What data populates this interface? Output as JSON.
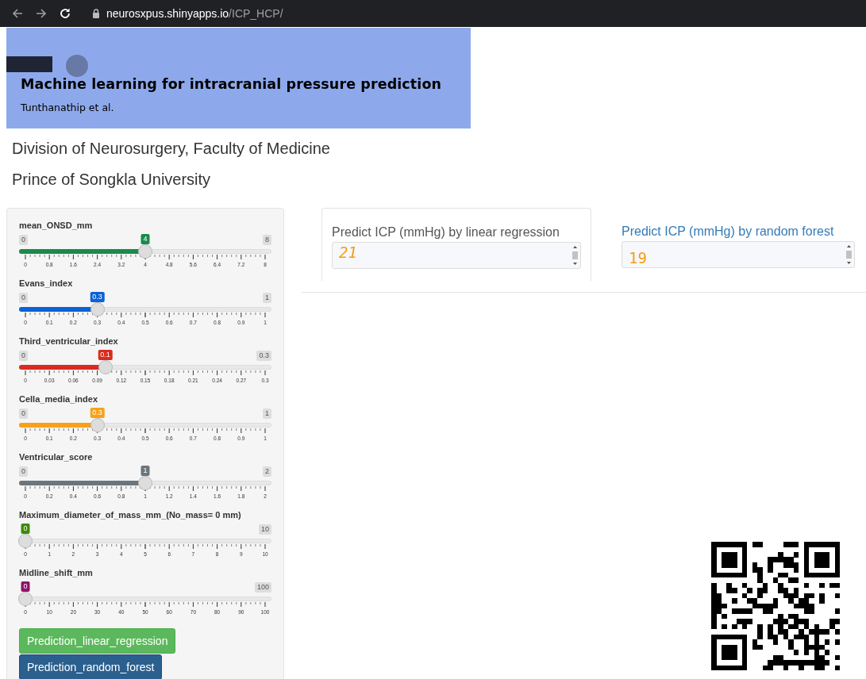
{
  "browser": {
    "url_host": "neurosxpus.shinyapps.io",
    "url_path": "/ICP_HCP/"
  },
  "banner": {
    "title": "Machine learning for intracranial pressure prediction",
    "subtitle": "Tunthanathip et al."
  },
  "header_lines": [
    "Division of Neurosurgery, Faculty of Medicine",
    "Prince of Songkla University"
  ],
  "sliders": [
    {
      "label": "mean_ONSD_mm",
      "min": "0",
      "max": "8",
      "value": "4",
      "level": 0.5,
      "color": "#1a8a4c",
      "ticks": [
        "0",
        "0.8",
        "1.6",
        "2.4",
        "3.2",
        "4",
        "4.8",
        "5.6",
        "6.4",
        "7.2",
        "8"
      ]
    },
    {
      "label": "Evans_index",
      "min": "0",
      "max": "1",
      "value": "0.3",
      "level": 0.3,
      "color": "#0b62d6",
      "ticks": [
        "0",
        "0.1",
        "0.2",
        "0.3",
        "0.4",
        "0.5",
        "0.6",
        "0.7",
        "0.8",
        "0.9",
        "1"
      ]
    },
    {
      "label": "Third_ventricular_index",
      "min": "0",
      "max": "0.3",
      "value": "0.1",
      "level": 0.333,
      "color": "#d92b1f",
      "ticks": [
        "0",
        "0.03",
        "0.06",
        "0.09",
        "0.12",
        "0.15",
        "0.18",
        "0.21",
        "0.24",
        "0.27",
        "0.3"
      ]
    },
    {
      "label": "Cella_media_index",
      "min": "0",
      "max": "1",
      "value": "0.3",
      "level": 0.3,
      "color": "#f7a11a",
      "ticks": [
        "0",
        "0.1",
        "0.2",
        "0.3",
        "0.4",
        "0.5",
        "0.6",
        "0.7",
        "0.8",
        "0.9",
        "1"
      ]
    },
    {
      "label": "Ventricular_score",
      "min": "0",
      "max": "2",
      "value": "1",
      "level": 0.5,
      "color": "#6b757d",
      "ticks": [
        "0",
        "0.2",
        "0.4",
        "0.6",
        "0.8",
        "1",
        "1.2",
        "1.4",
        "1.6",
        "1.8",
        "2"
      ]
    },
    {
      "label": "Maximum_diameter_of_mass_mm_(No_mass= 0 mm)",
      "max": "10",
      "value": "0",
      "level": 0,
      "color": "#3d8a0a",
      "ticks": [
        "0",
        "1",
        "2",
        "3",
        "4",
        "5",
        "6",
        "7",
        "8",
        "9",
        "10"
      ]
    },
    {
      "label": "Midline_shift_mm",
      "max": "100",
      "value": "0",
      "level": 0,
      "color": "#8c1566",
      "ticks": [
        "0",
        "10",
        "20",
        "30",
        "40",
        "50",
        "60",
        "70",
        "80",
        "90",
        "100"
      ]
    }
  ],
  "buttons": [
    {
      "label": "Prediction_linear_regression",
      "kind": "success"
    },
    {
      "label": "Prediction_random_forest",
      "kind": "primary"
    }
  ],
  "outputs": [
    {
      "label": "Predict ICP (mmHg) by linear regression",
      "value": "21",
      "kind": "card"
    },
    {
      "label": "Predict ICP (mmHg) by random forest",
      "value": "19",
      "kind": "plain"
    }
  ]
}
